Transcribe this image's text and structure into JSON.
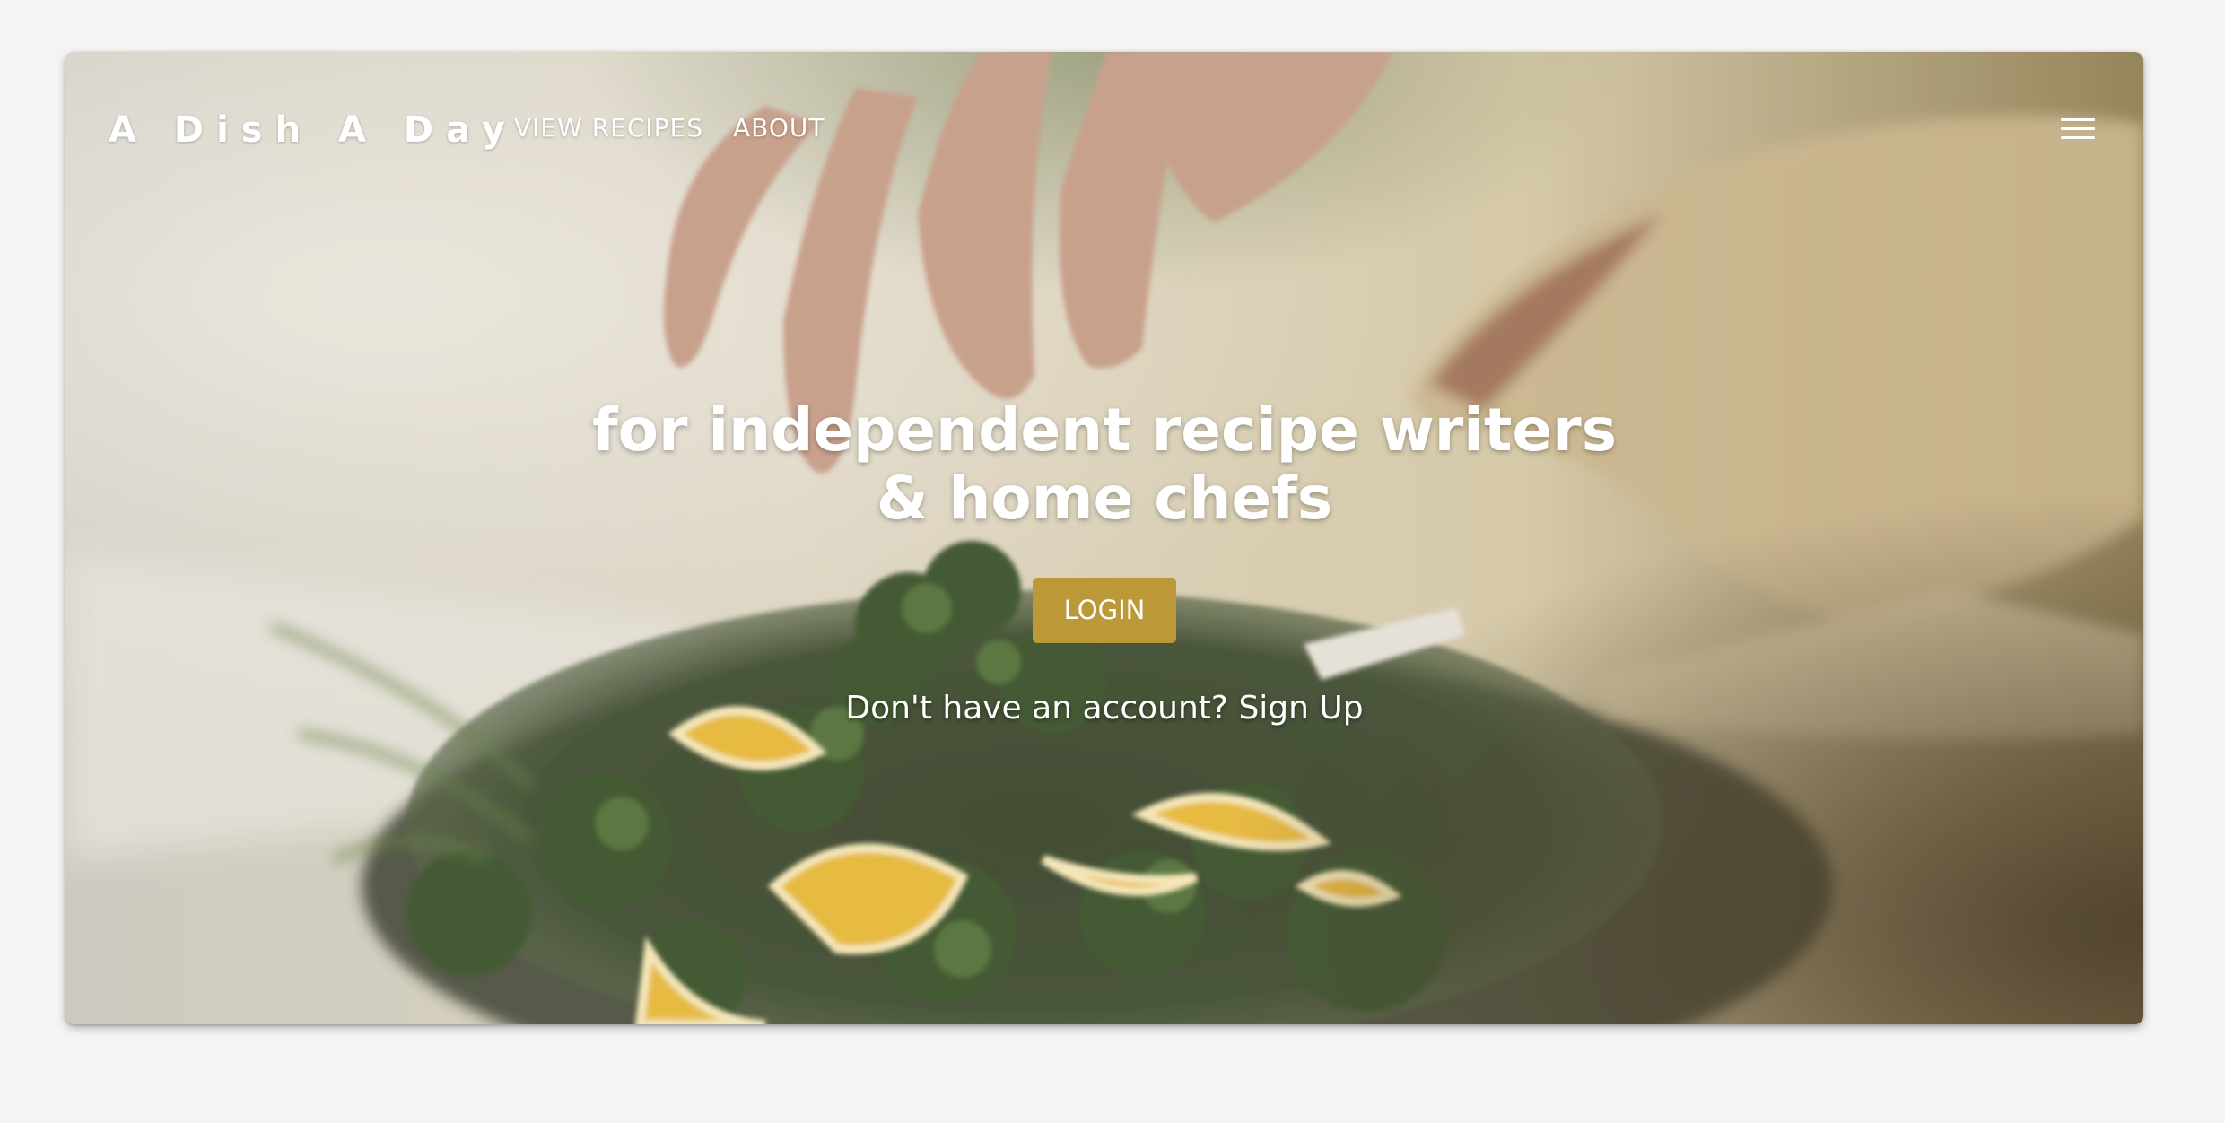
{
  "brand": {
    "name": "A Dish A Day"
  },
  "nav": {
    "links": [
      {
        "label": "VIEW RECIPES"
      },
      {
        "label": "ABOUT"
      }
    ],
    "menu_icon": "hamburger-menu-icon"
  },
  "hero": {
    "headline_line1": "for independent recipe writers",
    "headline_line2": "& home chefs",
    "login_label": "LOGIN",
    "signup_prompt": "Don't have an account?",
    "signup_link": "Sign Up",
    "background_image": "hands garnishing a bowl of broccolini and lemon slices"
  },
  "colors": {
    "accent": "#bb9938",
    "page_background": "#f5f4f2",
    "text_on_image": "#ffffff"
  }
}
